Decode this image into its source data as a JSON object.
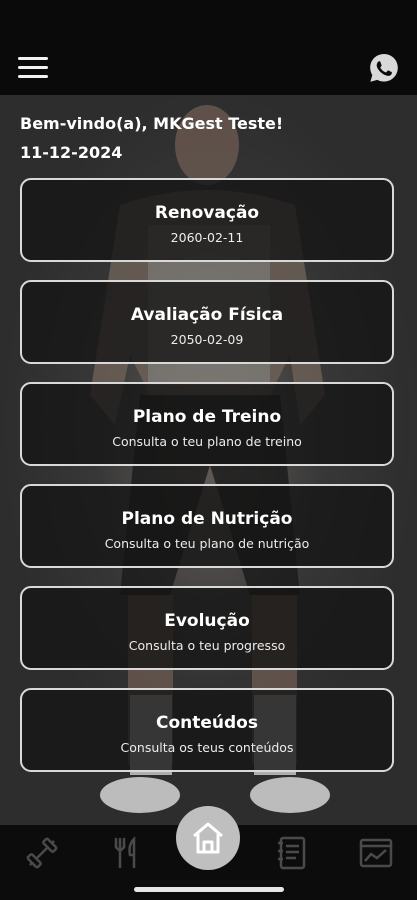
{
  "header": {
    "menu_icon": "hamburger-menu-icon",
    "whatsapp_icon": "whatsapp-icon"
  },
  "greeting": {
    "welcome": "Bem-vindo(a), MKGest Teste!",
    "date": "11-12-2024"
  },
  "cards": [
    {
      "title": "Renovação",
      "subtitle": "2060-02-11"
    },
    {
      "title": "Avaliação Física",
      "subtitle": "2050-02-09"
    },
    {
      "title": "Plano de Treino",
      "subtitle": "Consulta o teu plano de treino"
    },
    {
      "title": "Plano de Nutrição",
      "subtitle": "Consulta o teu plano de nutrição"
    },
    {
      "title": "Evolução",
      "subtitle": "Consulta o teu progresso"
    },
    {
      "title": "Conteúdos",
      "subtitle": "Consulta os teus conteúdos"
    }
  ],
  "bottom_nav": {
    "items": [
      {
        "icon": "dumbbell-icon"
      },
      {
        "icon": "fork-knife-icon"
      },
      {
        "icon": "home-icon"
      },
      {
        "icon": "notebook-icon"
      },
      {
        "icon": "chart-icon"
      }
    ]
  },
  "colors": {
    "background": "#3b3b3b",
    "card_border": "#d9d9d9",
    "home_button": "#bfbfbf",
    "nav_icon": "#4a4a4a",
    "whatsapp": "#d9d9d9"
  }
}
